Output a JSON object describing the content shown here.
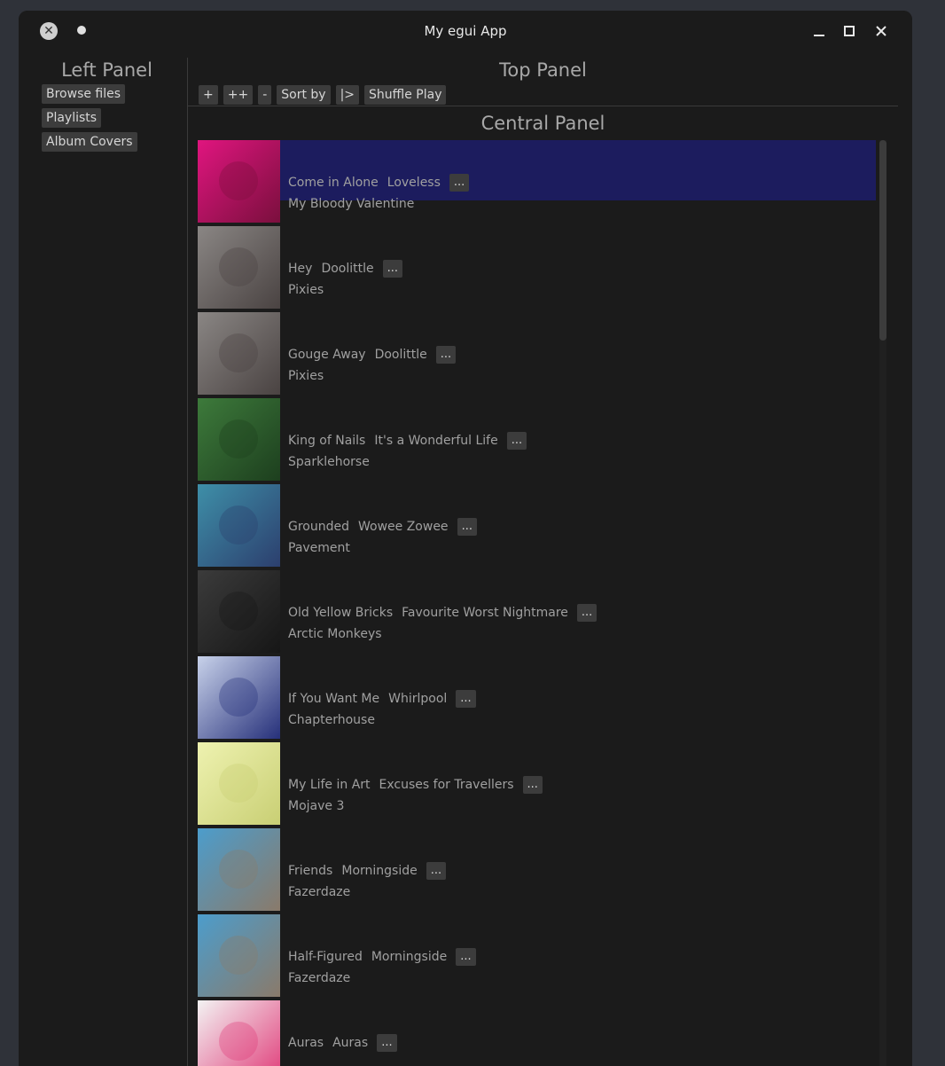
{
  "window": {
    "title": "My egui App"
  },
  "left_panel": {
    "heading": "Left Panel",
    "buttons": [
      "Browse files",
      "Playlists",
      "Album Covers"
    ]
  },
  "top_panel": {
    "heading": "Top Panel",
    "toolbar": [
      "+",
      "++",
      "-",
      "Sort by",
      "|>",
      "Shuffle Play"
    ]
  },
  "central_panel": {
    "heading": "Central Panel",
    "more_label": "...",
    "tracks": [
      {
        "title": "Come in Alone",
        "album": "Loveless",
        "artist": "My Bloody Valentine",
        "selected": true,
        "cover_colors": [
          "#e0157f",
          "#7a0f3d"
        ]
      },
      {
        "title": "Hey",
        "album": "Doolittle",
        "artist": "Pixies",
        "selected": false,
        "cover_colors": [
          "#8a8684",
          "#4a4342"
        ]
      },
      {
        "title": "Gouge Away",
        "album": "Doolittle",
        "artist": "Pixies",
        "selected": false,
        "cover_colors": [
          "#8a8684",
          "#4a4342"
        ]
      },
      {
        "title": "King of Nails",
        "album": "It's a Wonderful Life",
        "artist": "Sparklehorse",
        "selected": false,
        "cover_colors": [
          "#3d7a3b",
          "#1d3f1e"
        ]
      },
      {
        "title": "Grounded",
        "album": "Wowee Zowee",
        "artist": "Pavement",
        "selected": false,
        "cover_colors": [
          "#3e8fa8",
          "#2c3f6e"
        ]
      },
      {
        "title": "Old Yellow Bricks",
        "album": "Favourite Worst Nightmare",
        "artist": "Arctic Monkeys",
        "selected": false,
        "cover_colors": [
          "#3b3b3b",
          "#161616"
        ]
      },
      {
        "title": "If You Want Me",
        "album": "Whirlpool",
        "artist": "Chapterhouse",
        "selected": false,
        "cover_colors": [
          "#c8d2ea",
          "#26307a"
        ]
      },
      {
        "title": "My Life in Art",
        "album": "Excuses for Travellers",
        "artist": "Mojave 3",
        "selected": false,
        "cover_colors": [
          "#eef2b0",
          "#c9cf74"
        ]
      },
      {
        "title": "Friends",
        "album": "Morningside",
        "artist": "Fazerdaze",
        "selected": false,
        "cover_colors": [
          "#4c9dcc",
          "#8a7a6a"
        ]
      },
      {
        "title": "Half-Figured",
        "album": "Morningside",
        "artist": "Fazerdaze",
        "selected": false,
        "cover_colors": [
          "#4c9dcc",
          "#8a7a6a"
        ]
      },
      {
        "title": "Auras",
        "album": "Auras",
        "artist": "",
        "selected": false,
        "cover_colors": [
          "#f3f3f3",
          "#e03a78"
        ]
      }
    ]
  }
}
